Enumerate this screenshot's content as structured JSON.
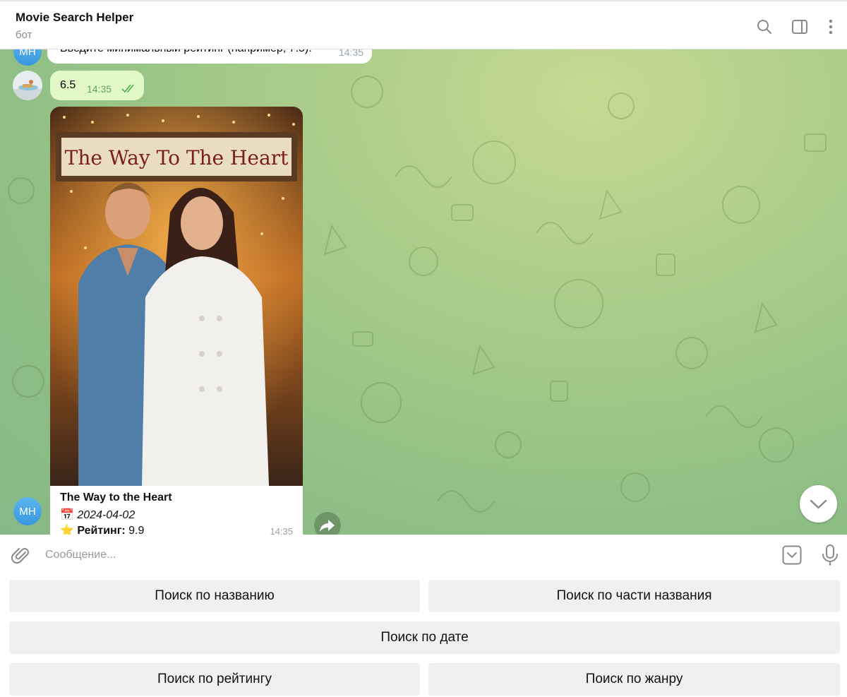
{
  "header": {
    "title": "Movie Search Helper",
    "subtitle": "бот",
    "icons": [
      "search-icon",
      "sidebar-toggle-icon",
      "more-vertical-icon"
    ]
  },
  "messages": {
    "partial_prompt": {
      "text": "Введите минимальный рейтинг (например, 7.5).",
      "time": "14:35",
      "avatar_initials": "MH"
    },
    "user_reply": {
      "text": "6.5",
      "time": "14:35",
      "status": "read"
    },
    "movie_card": {
      "poster_title": "The Way To The Heart",
      "title": "The Way to the Heart",
      "date_icon": "📅",
      "date": "2024-04-02",
      "rating_icon": "⭐",
      "rating_label": "Рейтинг:",
      "rating_value": "9.9",
      "time": "14:35",
      "avatar_initials": "MH"
    }
  },
  "composer": {
    "placeholder": "Сообщение...",
    "value": ""
  },
  "keyboard": {
    "btn_title": "Поиск по названию",
    "btn_partial": "Поиск по части названия",
    "btn_date": "Поиск по дате",
    "btn_rating": "Поиск по рейтингу",
    "btn_genre": "Поиск по жанру"
  },
  "colors": {
    "accent": "#3a97dd",
    "outgoing_bubble": "#e3f8c7",
    "read_check": "#4fae4e",
    "chat_bg": "#a9cc8a"
  }
}
